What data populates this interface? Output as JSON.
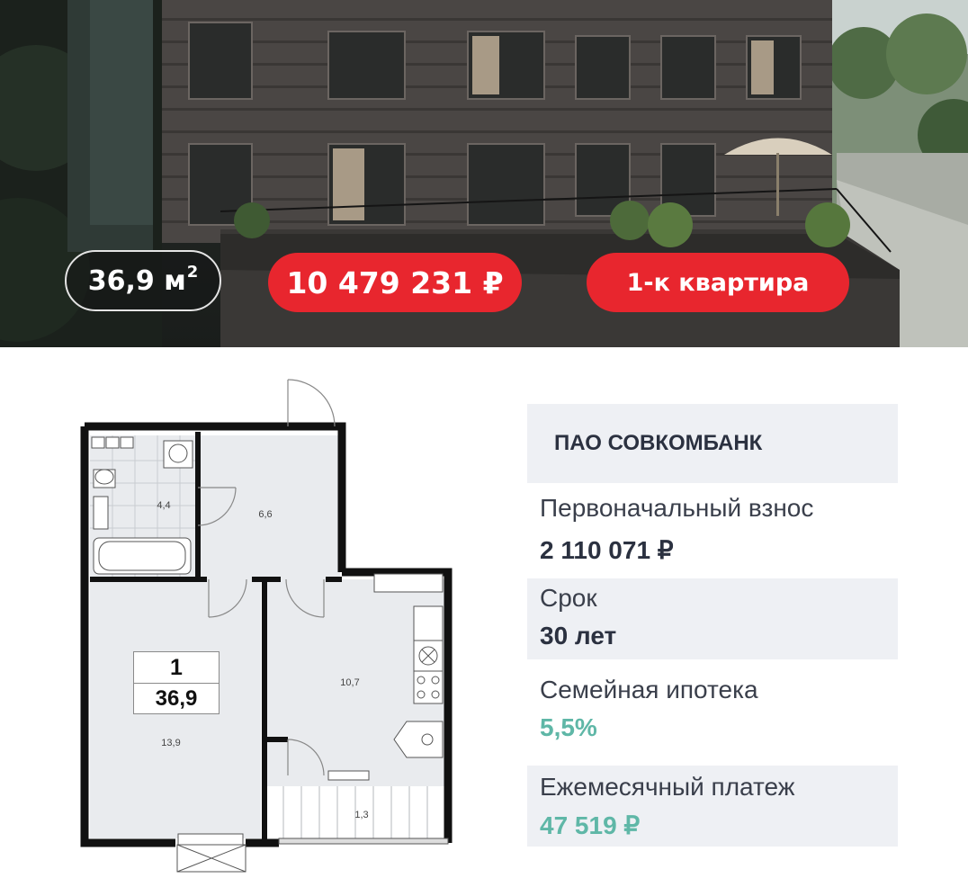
{
  "hero": {
    "area_value": "36,9 м",
    "area_sup": "2",
    "price": "10 479 231 ₽",
    "apartment_type": "1-к квартира"
  },
  "plan": {
    "room_number": "1",
    "total_area": "36,9",
    "rooms": {
      "bathroom": "4,4",
      "hall": "6,6",
      "living": "13,9",
      "kitchen": "10,7",
      "balcony": "1,3"
    }
  },
  "mortgage": {
    "bank_name": "ПАО СОВКОМБАНК",
    "down_payment_label": "Первоначальный взнос",
    "down_payment_value": "2 110 071 ₽",
    "term_label": "Срок",
    "term_value": "30 лет",
    "program_label": "Семейная ипотека",
    "program_rate": "5,5%",
    "monthly_label": "Ежемесячный платеж",
    "monthly_value": "47 519 ₽"
  },
  "colors": {
    "accent_red": "#e8262e",
    "rate_green": "#5fb7a7",
    "panel_bg": "#eef0f4",
    "text_dark": "#2b3140"
  }
}
